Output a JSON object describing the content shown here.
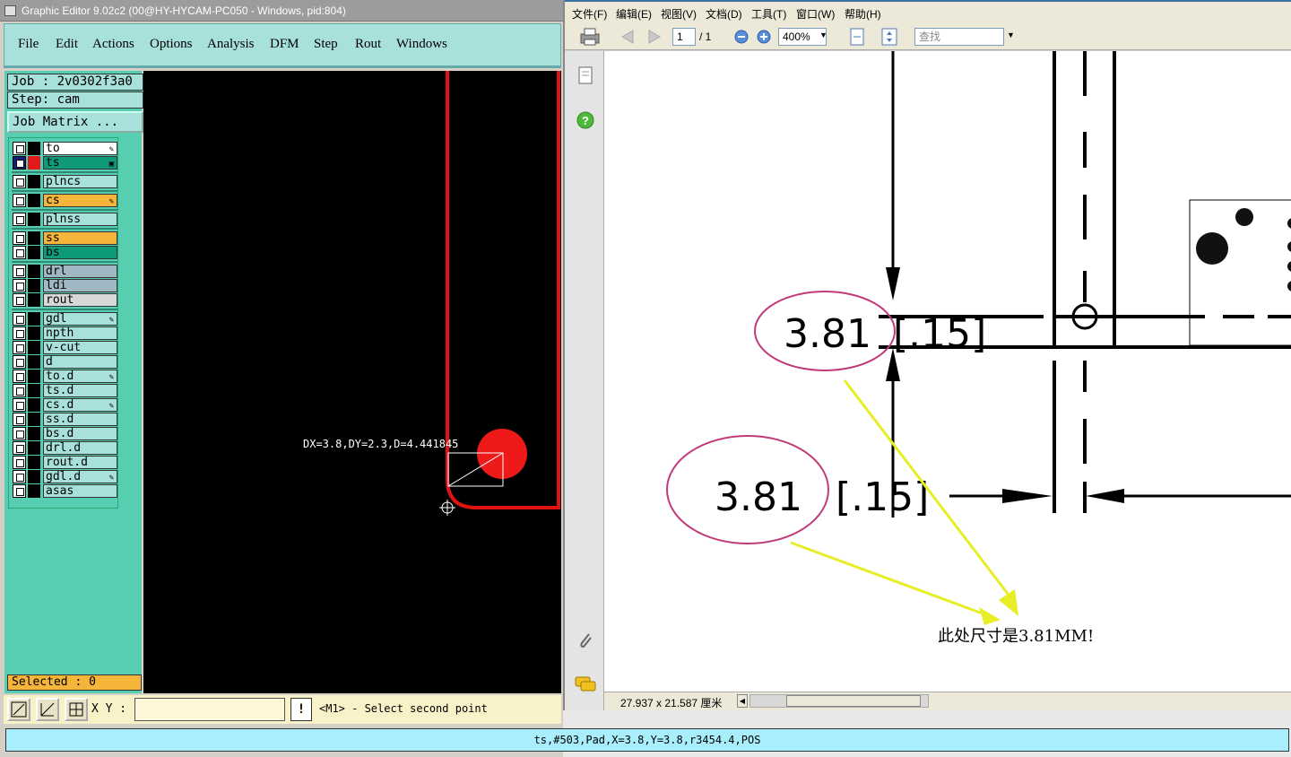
{
  "ge": {
    "title": "Graphic Editor 9.02c2 (00@HY-HYCAM-PC050 - Windows, pid:804)",
    "menu": [
      "File",
      "Edit",
      "Actions",
      "Options",
      "Analysis",
      "DFM",
      "Step",
      "Rout",
      "Windows"
    ],
    "job_label": "Job : 2v0302f3a0",
    "step_label": "Step: cam",
    "job_matrix_label": "Job Matrix ...",
    "layers": [
      {
        "name": "to",
        "color": "#ffffff",
        "active": false,
        "pen": true
      },
      {
        "name": "ts",
        "color": "#0f9a7a",
        "active": true,
        "pen": false,
        "marker": true
      },
      {
        "name": "plncs",
        "color": "#a8e0dc",
        "active": false,
        "pen": false
      },
      {
        "name": "cs",
        "color": "#f5b43a",
        "active": false,
        "pen": true
      },
      {
        "name": "plnss",
        "color": "#a8e0dc",
        "active": false,
        "pen": false
      },
      {
        "name": "ss",
        "color": "#f5b43a",
        "active": false,
        "pen": false
      },
      {
        "name": "bs",
        "color": "#0f9a7a",
        "active": false,
        "pen": false
      },
      {
        "name": "drl",
        "color": "#a0b8c4",
        "active": false,
        "pen": false
      },
      {
        "name": "ldi",
        "color": "#a0b8c4",
        "active": false,
        "pen": false
      },
      {
        "name": "rout",
        "color": "#d8d8d8",
        "active": false,
        "pen": false
      },
      {
        "name": "gdl",
        "color": "#a8e0dc",
        "active": false,
        "pen": true
      },
      {
        "name": "npth",
        "color": "#a8e0dc",
        "active": false,
        "pen": false
      },
      {
        "name": "v-cut",
        "color": "#a8e0dc",
        "active": false,
        "pen": false
      },
      {
        "name": "d",
        "color": "#a8e0dc",
        "active": false,
        "pen": false
      },
      {
        "name": "to.d",
        "color": "#a8e0dc",
        "active": false,
        "pen": true
      },
      {
        "name": "ts.d",
        "color": "#a8e0dc",
        "active": false,
        "pen": false
      },
      {
        "name": "cs.d",
        "color": "#a8e0dc",
        "active": false,
        "pen": true
      },
      {
        "name": "ss.d",
        "color": "#a8e0dc",
        "active": false,
        "pen": false
      },
      {
        "name": "bs.d",
        "color": "#a8e0dc",
        "active": false,
        "pen": false
      },
      {
        "name": "drl.d",
        "color": "#a8e0dc",
        "active": false,
        "pen": false
      },
      {
        "name": "rout.d",
        "color": "#a8e0dc",
        "active": false,
        "pen": false
      },
      {
        "name": "gdl.d",
        "color": "#a8e0dc",
        "active": false,
        "pen": true
      },
      {
        "name": "asas",
        "color": "#a8e0dc",
        "active": false,
        "pen": false
      }
    ],
    "selected_label": "Selected : 0",
    "measure_text": "DX=3.8,DY=2.3,D=4.441845",
    "xy_label": "X Y :",
    "xy_value": "",
    "exclaim": "!",
    "prompt": "<M1> - Select second point",
    "status": "ts,#503,Pad,X=3.8,Y=3.8,r3454.4,POS"
  },
  "pdf": {
    "menu": [
      "文件(F)",
      "编辑(E)",
      "视图(V)",
      "文档(D)",
      "工具(T)",
      "窗口(W)",
      "帮助(H)"
    ],
    "page_current": "1",
    "page_total": "/ 1",
    "zoom": "400%",
    "search_placeholder": "查找",
    "page_size": "27.937 x 21.587 厘米",
    "dims": {
      "label_top": "3.81",
      "label_top_inch": "[.15]",
      "label_bottom": "3.81",
      "label_bottom_inch": "[.15]",
      "note": "此处尺寸是3.81MM!"
    }
  }
}
